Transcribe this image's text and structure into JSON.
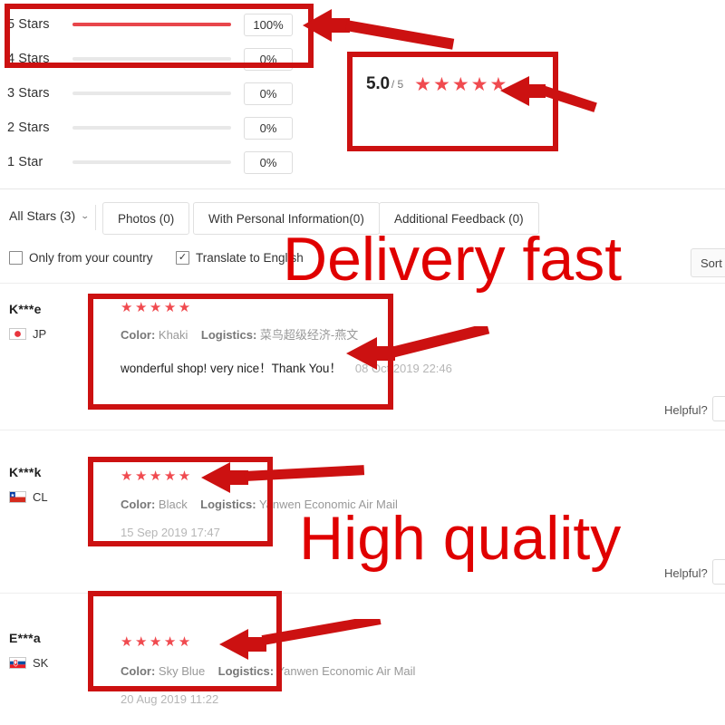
{
  "rating_summary": {
    "bars": [
      {
        "label": "5 Stars",
        "percent": "100%",
        "fill": 100
      },
      {
        "label": "4 Stars",
        "percent": "0%",
        "fill": 0
      },
      {
        "label": "3 Stars",
        "percent": "0%",
        "fill": 0
      },
      {
        "label": "2 Stars",
        "percent": "0%",
        "fill": 0
      },
      {
        "label": "1 Star",
        "percent": "0%",
        "fill": 0
      }
    ],
    "score": "5.0",
    "score_denominator": "/ 5",
    "score_stars": "★★★★★"
  },
  "filters": {
    "all_stars_label": "All Stars (3)",
    "chevron": "⌄",
    "chips": [
      {
        "label": "Photos (0)"
      },
      {
        "label": "With Personal Information(0)"
      },
      {
        "label": "Additional Feedback (0)"
      }
    ],
    "checkboxes": [
      {
        "label": "Only from your country",
        "checked": false,
        "mark": ""
      },
      {
        "label": "Translate to English",
        "checked": true,
        "mark": "✓"
      }
    ],
    "sort_by_label": "Sort b"
  },
  "reviews": [
    {
      "user": "K***e",
      "country_code": "JP",
      "flag": "jp",
      "stars": "★★★★★",
      "color_key": "Color:",
      "color_value": "Khaki",
      "logistics_key": "Logistics:",
      "logistics_value": "菜鸟超级经济-燕文",
      "text": "wonderful shop! very nice！Thank You！",
      "date": "08 Oct 2019 22:46",
      "helpful_label": "Helpful?"
    },
    {
      "user": "K***k",
      "country_code": "CL",
      "flag": "cl",
      "stars": "★★★★★",
      "color_key": "Color:",
      "color_value": "Black",
      "logistics_key": "Logistics:",
      "logistics_value": "Yanwen Economic Air Mail",
      "text": "",
      "date": "15 Sep 2019 17:47",
      "helpful_label": "Helpful?"
    },
    {
      "user": "E***a",
      "country_code": "SK",
      "flag": "sk",
      "stars": "★★★★★",
      "color_key": "Color:",
      "color_value": "Sky Blue",
      "logistics_key": "Logistics:",
      "logistics_value": "Yanwen Economic Air Mail",
      "text": "",
      "date": "20 Aug 2019 11:22",
      "helpful_label": ""
    }
  ],
  "annotations": {
    "text_delivery": "Delivery fast",
    "text_quality": "High quality"
  },
  "colors": {
    "annotation_red": "#cc1111",
    "annotation_text_red": "#e00000",
    "star_red": "#f04a4f",
    "bar_red": "#e8464b",
    "track_grey": "#e8e8e8"
  }
}
